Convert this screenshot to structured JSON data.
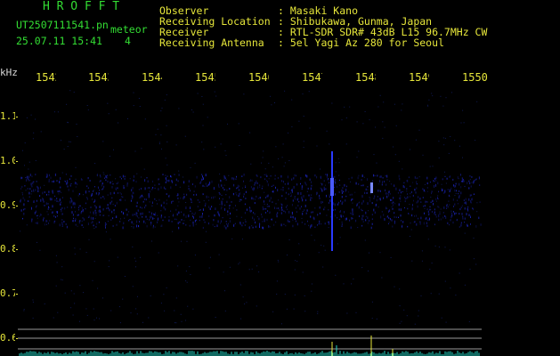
{
  "header": {
    "app_title": "H R O F F T",
    "file_name": "UT2507111541.pn",
    "timestamp": "25.07.11 15:41",
    "event_label": "meteor",
    "event_count": "4",
    "fields": [
      {
        "label": "Observer",
        "value": ": Masaki Kano"
      },
      {
        "label": "Receiving Location",
        "value": ": Shibukawa, Gunma, Japan"
      },
      {
        "label": "Receiver",
        "value": ": RTL-SDR SDR# 43dB L15 96.7MHz CW"
      },
      {
        "label": "Receiving Antenna",
        "value": ": 5el Yagi Az 280 for Seoul"
      }
    ]
  },
  "axes": {
    "y_unit": "kHz",
    "y_ticks": [
      "1.1",
      "1.0",
      "0.9",
      "0.8",
      "0.7",
      "0.6"
    ],
    "x_ticks": [
      "1542",
      "1543",
      "1544",
      "1545",
      "1546",
      "1547",
      "1548",
      "1549",
      "1550"
    ]
  },
  "colors": {
    "title_green": "#33dd33",
    "label_yellow": "#e6e63a",
    "signal_blue": "#2a3aff",
    "graph_line": "#9a9a9a",
    "spectrum": "#22d4c4"
  }
}
